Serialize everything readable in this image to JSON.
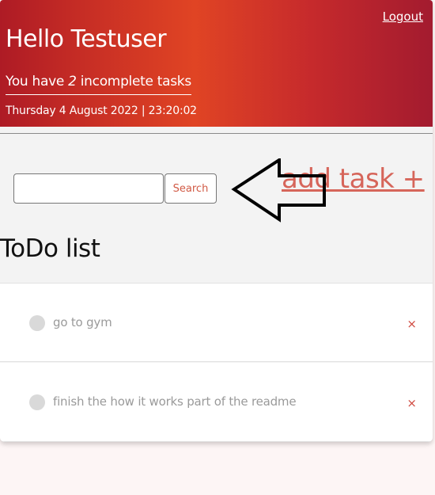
{
  "header": {
    "logout_label": "Logout",
    "greeting": "Hello Testuser",
    "incomplete_prefix": "You have ",
    "incomplete_count": "2",
    "incomplete_suffix": " incomplete tasks",
    "datetime": "Thursday 4 August 2022 | 23:20:02",
    "gradient_colors": [
      "#ae1b25",
      "#e04424",
      "#a31b2f"
    ]
  },
  "search": {
    "value": "",
    "placeholder": "",
    "button_label": "Search"
  },
  "add_task": {
    "label": "add task +",
    "color": "#d6655a"
  },
  "annotation": {
    "icon": "left-arrow-outline-icon"
  },
  "todo_list": {
    "title": "ToDo list",
    "items": [
      {
        "text": "go to gym",
        "delete_label": "×"
      },
      {
        "text": "finish the how it works part of the readme",
        "delete_label": "×"
      }
    ]
  }
}
